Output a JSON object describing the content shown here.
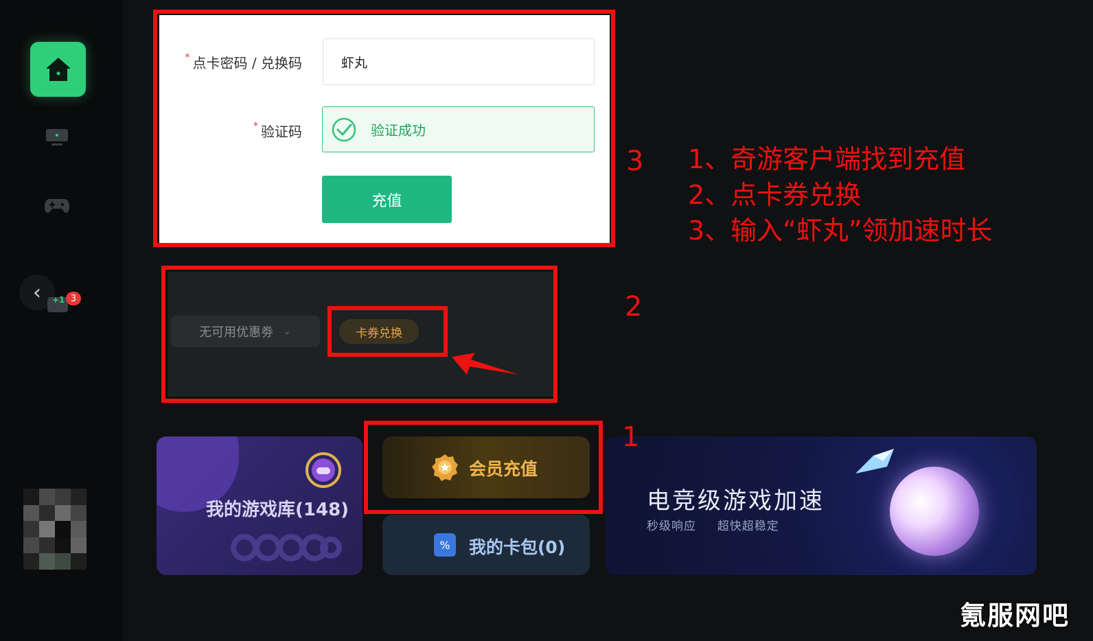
{
  "form": {
    "code_label": "点卡密码 / 兑换码",
    "code_value": "虾丸",
    "captcha_label": "验证码",
    "captcha_status": "验证成功",
    "required_mark": "*",
    "submit_label": "充值"
  },
  "coupon": {
    "select_label": "无可用优惠劵",
    "redeem_label": "卡券兑换"
  },
  "sidebar": {
    "badge_count": "3",
    "plus_one": "+1"
  },
  "cards": {
    "game_library": "我的游戏库(148)",
    "member_recharge": "会员充值",
    "card_wallet": "我的卡包(0)",
    "speed_title": "电竞级游戏加速",
    "speed_sub1": "秒级响应",
    "speed_sub2": "超快超稳定"
  },
  "annotations": {
    "step1": "1",
    "step2": "2",
    "step3": "3",
    "instructions": [
      "1、奇游客户端找到充值",
      "2、点卡券兑换",
      "3、输入“虾丸”领加速时长"
    ]
  },
  "watermark": "氪服网吧",
  "colors": {
    "accent_green": "#2fcf7a",
    "button_green": "#1fb883",
    "annotation_red": "#ee1111",
    "gold": "#f0b64c"
  }
}
